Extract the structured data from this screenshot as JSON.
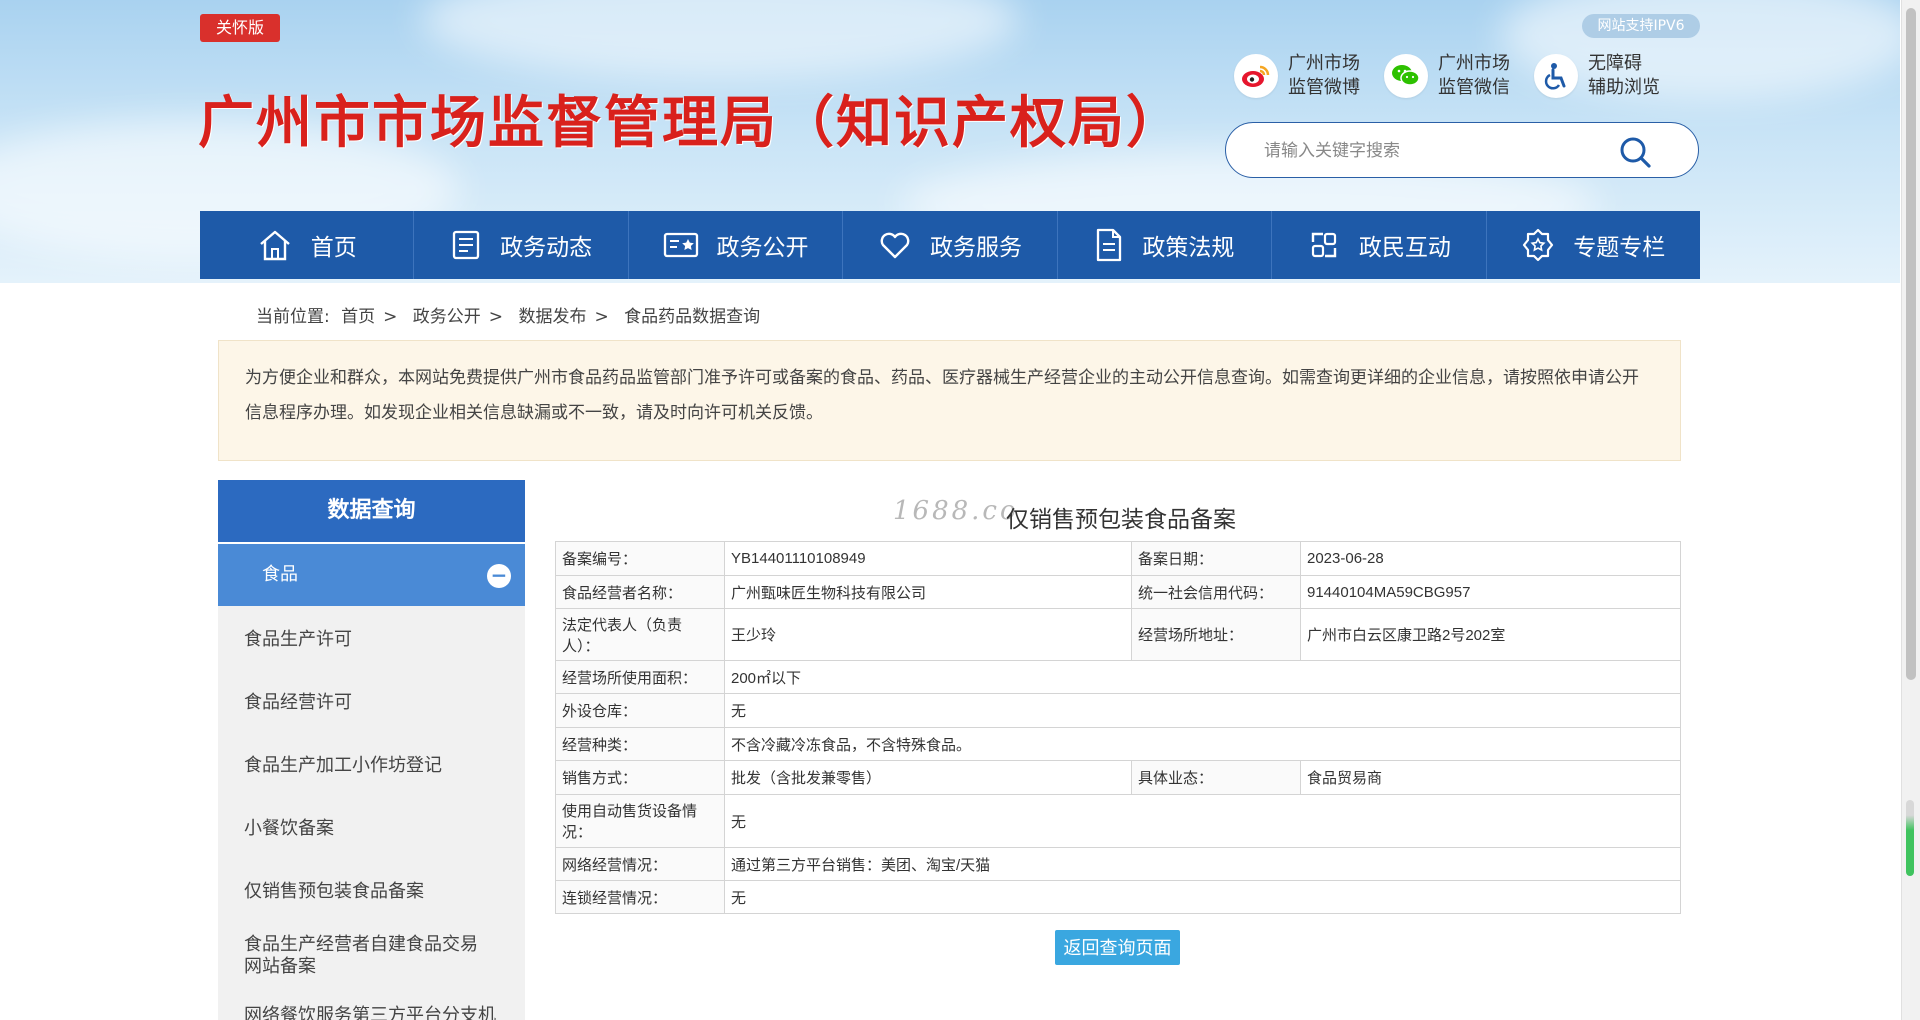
{
  "header": {
    "care_badge": "关怀版",
    "site_title": "广州市市场监督管理局（知识产权局）",
    "ipv6_badge": "网站支持IPV6",
    "links": [
      {
        "line1": "广州市场",
        "line2": "监管微博",
        "icon": "weibo-icon"
      },
      {
        "line1": "广州市场",
        "line2": "监管微信",
        "icon": "wechat-icon"
      },
      {
        "line1": "无障碍",
        "line2": "辅助浏览",
        "icon": "accessibility-icon"
      }
    ],
    "search_placeholder": "请输入关键字搜索"
  },
  "nav": [
    {
      "label": "首页",
      "icon": "home-icon"
    },
    {
      "label": "政务动态",
      "icon": "news-icon"
    },
    {
      "label": "政务公开",
      "icon": "disclosure-icon"
    },
    {
      "label": "政务服务",
      "icon": "heart-icon"
    },
    {
      "label": "政策法规",
      "icon": "document-icon"
    },
    {
      "label": "政民互动",
      "icon": "interaction-icon"
    },
    {
      "label": "专题专栏",
      "icon": "badge-icon"
    }
  ],
  "breadcrumb": {
    "prefix": "当前位置:",
    "items": [
      "首页",
      "政务公开",
      "数据发布",
      "食品药品数据查询"
    ],
    "separator": ">"
  },
  "notice": "为方便企业和群众，本网站免费提供广州市食品药品监管部门准予许可或备案的食品、药品、医疗器械生产经营企业的主动公开信息查询。如需查询更详细的企业信息，请按照依申请公开信息程序办理。如发现企业相关信息缺漏或不一致，请及时向许可机关反馈。",
  "sidebar": {
    "heading": "数据查询",
    "category": "食品",
    "items": [
      "食品生产许可",
      "食品经营许可",
      "食品生产加工小作坊登记",
      "小餐饮备案",
      "仅销售预包装食品备案",
      "食品生产经营者自建食品交易网站备案",
      "网络餐饮服务第三方平台分支机"
    ]
  },
  "main": {
    "watermark": "1688.co",
    "title": "仅销售预包装食品备案",
    "rows": [
      {
        "label": "备案编号：",
        "value": "YB14401110108949",
        "label2": "备案日期：",
        "value2": "2023-06-28"
      },
      {
        "label": "食品经营者名称：",
        "value": "广州甄味匠生物科技有限公司",
        "label2": "统一社会信用代码：",
        "value2": "91440104MA59CBG957"
      },
      {
        "label": "法定代表人（负责人）：",
        "value": "王少玲",
        "label2": "经营场所地址：",
        "value2": "广州市白云区康卫路2号202室"
      },
      {
        "label": "经营场所使用面积：",
        "value": "200㎡以下"
      },
      {
        "label": "外设仓库：",
        "value": "无"
      },
      {
        "label": "经营种类：",
        "value": "不含冷藏冷冻食品，不含特殊食品。"
      },
      {
        "label": "销售方式：",
        "value": "批发（含批发兼零售）",
        "label2": "具体业态：",
        "value2": "食品贸易商"
      },
      {
        "label": "使用自动售货设备情况：",
        "value": "无"
      },
      {
        "label": "网络经营情况：",
        "value": "通过第三方平台销售：美团、淘宝/天猫"
      },
      {
        "label": "连锁经营情况：",
        "value": "无"
      }
    ],
    "back_button": "返回查询页面"
  },
  "colors": {
    "title_red": "#d9211c",
    "nav_blue": "#1e5aa8",
    "sidebar_head": "#2c6ac0",
    "sidebar_active": "#4a8ad6",
    "button_blue": "#3aa7e0",
    "notice_bg": "#fdf6e8"
  }
}
